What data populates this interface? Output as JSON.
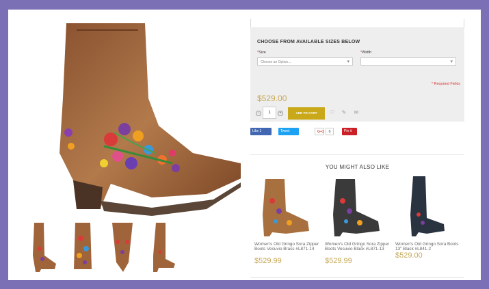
{
  "options": {
    "heading": "CHOOSE FROM AVAILABLE SIZES BELOW",
    "size_label": "Size",
    "size_placeholder": "Choose an Option...",
    "width_label": "Width",
    "width_value": "",
    "required_note": "* Required Fields",
    "required_mark": "*"
  },
  "price": "$529.00",
  "quantity": "1",
  "add_to_cart_label": "ADD TO CART",
  "social": {
    "like": "Like 1",
    "tweet": "Tweet",
    "gplus": "G+1",
    "gplus_count": "0",
    "pin": "Pin it"
  },
  "related": {
    "heading": "YOU MIGHT ALSO LIKE",
    "items": [
      {
        "name": "Women's Old Gringo Sora Zipper Boots Vesuvio Brass #L871-14",
        "price": "$529.99"
      },
      {
        "name": "Women's Old Gringo Sora Zipper Boots Vesuvio Black #L871-13",
        "price": "$529.99"
      },
      {
        "name": "Women's Old Gringo Sora Boots 13\" Black #L841-2",
        "price": "$529.00"
      }
    ]
  },
  "colors": {
    "frame": "#7b6fb6",
    "accent_gold": "#c9a91a",
    "price_gold": "#c7a95a",
    "required_red": "#d33333",
    "boot_brown": "#a0643a"
  },
  "icons": [
    "heart-icon",
    "pencil-icon",
    "envelope-icon",
    "minus-icon",
    "plus-icon",
    "chevron-down-icon"
  ]
}
